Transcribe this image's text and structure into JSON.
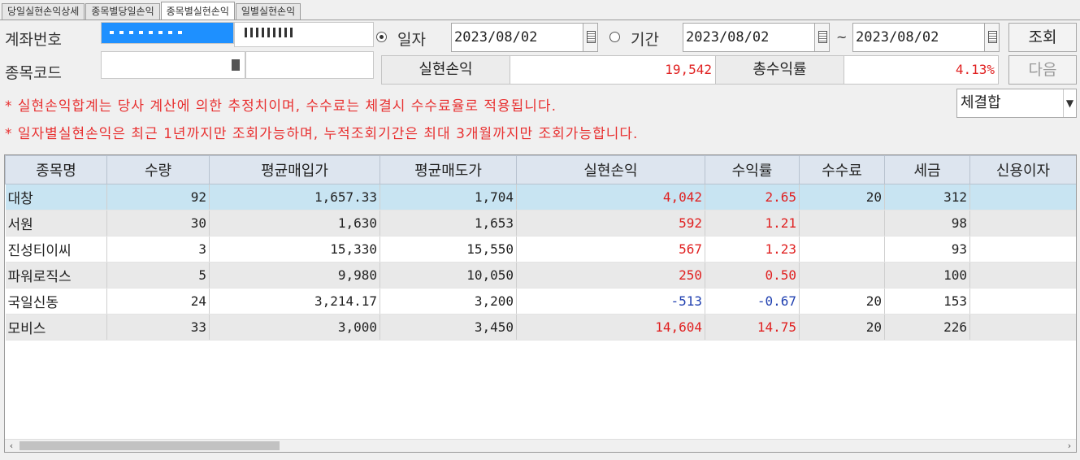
{
  "tabs": [
    "당일실현손익상세",
    "종목별당일손익",
    "종목별실현손익",
    "일별실현손익"
  ],
  "form": {
    "account_label": "계좌번호",
    "code_label": "종목코드",
    "date_radio_label": "일자",
    "period_radio_label": "기간",
    "date_value": "2023/08/02",
    "period_from": "2023/08/02",
    "period_to": "2023/08/02",
    "tilde": "~",
    "query_button": "조회",
    "next_button": "다음",
    "realized_label": "실현손익",
    "realized_value": "19,542",
    "total_return_label": "총수익률",
    "total_return_value": "4.13%",
    "select_value": "체결합"
  },
  "notices": [
    "* 실현손익합계는 당사 계산에 의한 추정치이며, 수수료는 체결시 수수료율로 적용됩니다.",
    "* 일자별실현손익은 최근 1년까지만 조회가능하며, 누적조회기간은 최대 3개월까지만 조회가능합니다."
  ],
  "grid": {
    "columns": [
      "종목명",
      "수량",
      "평균매입가",
      "평균매도가",
      "실현손익",
      "수익률",
      "수수료",
      "세금",
      "신용이자"
    ],
    "rows": [
      [
        "대창",
        "92",
        "1,657.33",
        "1,704",
        "4,042",
        "2.65",
        "20",
        "312",
        ""
      ],
      [
        "서원",
        "30",
        "1,630",
        "1,653",
        "592",
        "1.21",
        "",
        "98",
        ""
      ],
      [
        "진성티이씨",
        "3",
        "15,330",
        "15,550",
        "567",
        "1.23",
        "",
        "93",
        ""
      ],
      [
        "파워로직스",
        "5",
        "9,980",
        "10,050",
        "250",
        "0.50",
        "",
        "100",
        ""
      ],
      [
        "국일신동",
        "24",
        "3,214.17",
        "3,200",
        "-513",
        "-0.67",
        "20",
        "153",
        ""
      ],
      [
        "모비스",
        "33",
        "3,000",
        "3,450",
        "14,604",
        "14.75",
        "20",
        "226",
        ""
      ]
    ]
  },
  "colors": {
    "positive": "#e02020",
    "negative": "#2040b0",
    "selected_row": "#c8e4f2",
    "header": "#dde5ef"
  }
}
